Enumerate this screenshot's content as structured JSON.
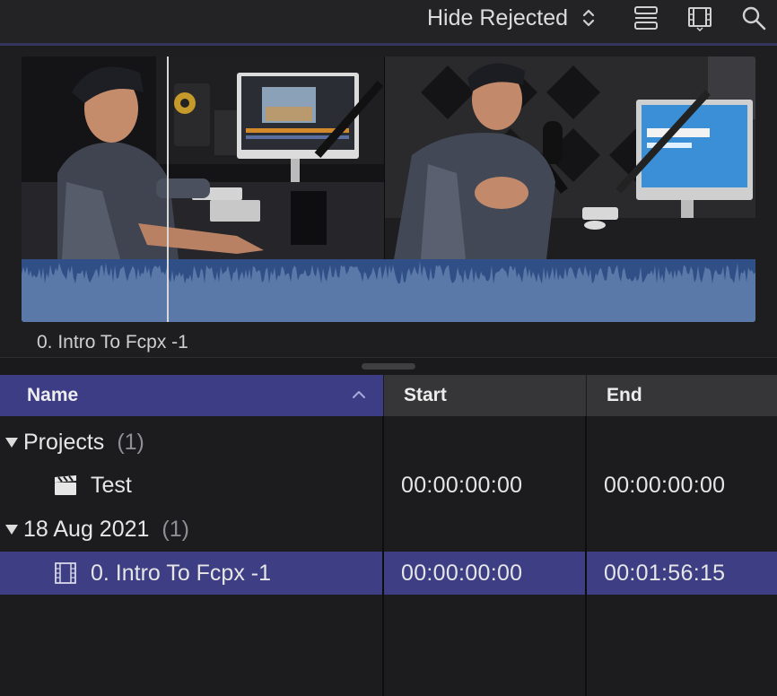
{
  "toolbar": {
    "filter_label": "Hide Rejected",
    "icons": [
      "filter-chevron-icon",
      "clip-appearance-icon",
      "filmstrip-view-icon",
      "search-icon"
    ]
  },
  "browser": {
    "clip_name": "0. Intro To Fcpx -1",
    "colors": {
      "waveform": "#5a78a8",
      "selection": "#3e3e84",
      "header_selected": "#3d3d86"
    }
  },
  "list": {
    "columns": {
      "name": "Name",
      "start": "Start",
      "end": "End"
    },
    "groups": [
      {
        "label": "Projects",
        "count": "(1)",
        "items": [
          {
            "name": "Test",
            "icon": "clapperboard-icon",
            "start": "00:00:00:00",
            "end": "00:00:00:00"
          }
        ]
      },
      {
        "label": "18 Aug 2021",
        "count": "(1)",
        "items": [
          {
            "name": "0. Intro To Fcpx -1",
            "icon": "film-clip-icon",
            "start": "00:00:00:00",
            "end": "00:01:56:15",
            "selected": true
          }
        ]
      }
    ]
  }
}
